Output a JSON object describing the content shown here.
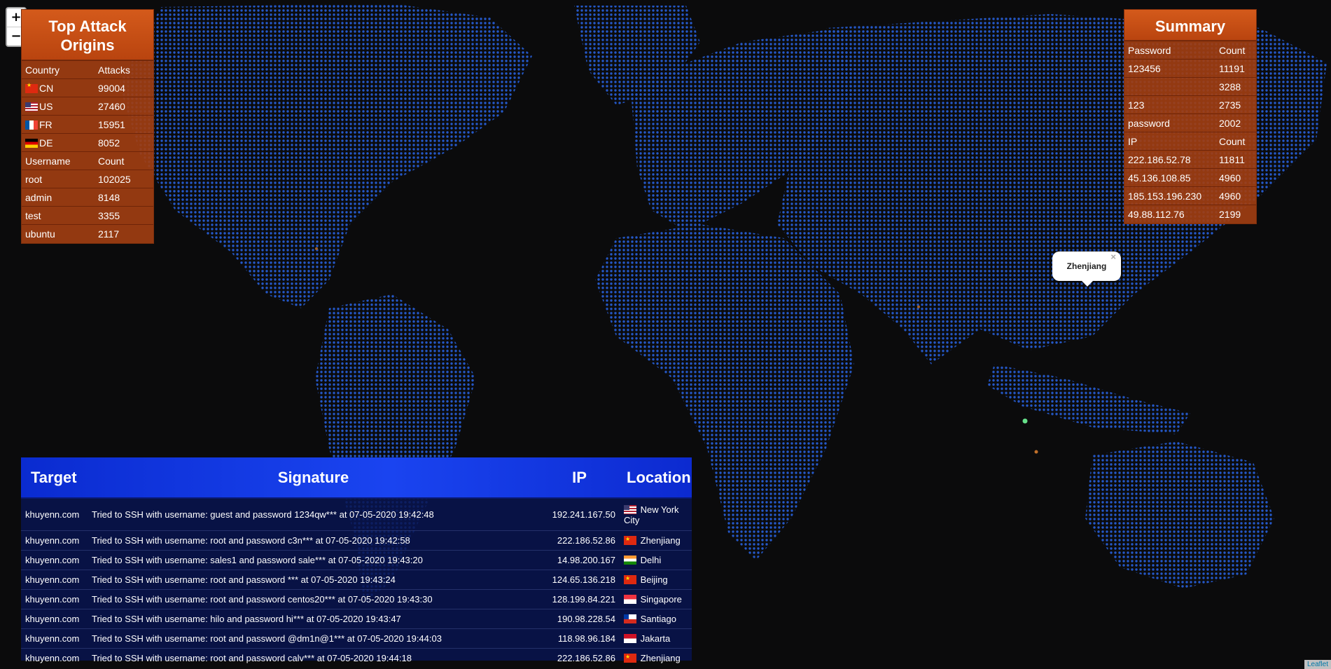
{
  "zoom": {
    "in_label": "+",
    "out_label": "−"
  },
  "top_origins": {
    "title": "Top Attack Origins",
    "country_header": [
      "Country",
      "Attacks"
    ],
    "countries": [
      {
        "flag": "cn",
        "code": "CN",
        "count": "99004"
      },
      {
        "flag": "us",
        "code": "US",
        "count": "27460"
      },
      {
        "flag": "fr",
        "code": "FR",
        "count": "15951"
      },
      {
        "flag": "de",
        "code": "DE",
        "count": "8052"
      }
    ],
    "username_header": [
      "Username",
      "Count"
    ],
    "usernames": [
      {
        "name": "root",
        "count": "102025"
      },
      {
        "name": "admin",
        "count": "8148"
      },
      {
        "name": "test",
        "count": "3355"
      },
      {
        "name": "ubuntu",
        "count": "2117"
      }
    ]
  },
  "summary": {
    "title": "Summary",
    "password_header": [
      "Password",
      "Count"
    ],
    "passwords": [
      {
        "value": "123456",
        "count": "11191"
      },
      {
        "value": "",
        "count": "3288"
      },
      {
        "value": "123",
        "count": "2735"
      },
      {
        "value": "password",
        "count": "2002"
      }
    ],
    "ip_header": [
      "IP",
      "Count"
    ],
    "ips": [
      {
        "value": "222.186.52.78",
        "count": "11811"
      },
      {
        "value": "45.136.108.85",
        "count": "4960"
      },
      {
        "value": "185.153.196.230",
        "count": "4960"
      },
      {
        "value": "49.88.112.76",
        "count": "2199"
      }
    ]
  },
  "log": {
    "headers": {
      "target": "Target",
      "signature": "Signature",
      "ip": "IP",
      "location": "Location"
    },
    "rows": [
      {
        "target": "khuyenn.com",
        "signature": "Tried to SSH with username: guest and password 1234qw*** at 07-05-2020 19:42:48",
        "ip": "192.241.167.50",
        "flag": "us",
        "location": "New York City"
      },
      {
        "target": "khuyenn.com",
        "signature": "Tried to SSH with username: root and password c3n*** at 07-05-2020 19:42:58",
        "ip": "222.186.52.86",
        "flag": "cn",
        "location": "Zhenjiang"
      },
      {
        "target": "khuyenn.com",
        "signature": "Tried to SSH with username: sales1 and password sale*** at 07-05-2020 19:43:20",
        "ip": "14.98.200.167",
        "flag": "in",
        "location": "Delhi"
      },
      {
        "target": "khuyenn.com",
        "signature": "Tried to SSH with username: root and password *** at 07-05-2020 19:43:24",
        "ip": "124.65.136.218",
        "flag": "cn",
        "location": "Beijing"
      },
      {
        "target": "khuyenn.com",
        "signature": "Tried to SSH with username: root and password centos20*** at 07-05-2020 19:43:30",
        "ip": "128.199.84.221",
        "flag": "sg",
        "location": "Singapore"
      },
      {
        "target": "khuyenn.com",
        "signature": "Tried to SSH with username: hilo and password hi*** at 07-05-2020 19:43:47",
        "ip": "190.98.228.54",
        "flag": "cl",
        "location": "Santiago"
      },
      {
        "target": "khuyenn.com",
        "signature": "Tried to SSH with username: root and password @dm1n@1*** at 07-05-2020 19:44:03",
        "ip": "118.98.96.184",
        "flag": "id",
        "location": "Jakarta"
      },
      {
        "target": "khuyenn.com",
        "signature": "Tried to SSH with username: root and password calv*** at 07-05-2020 19:44:18",
        "ip": "222.186.52.86",
        "flag": "cn",
        "location": "Zhenjiang"
      }
    ]
  },
  "popup": {
    "text": "Zhenjiang",
    "close": "×"
  },
  "attribution": "Leaflet"
}
